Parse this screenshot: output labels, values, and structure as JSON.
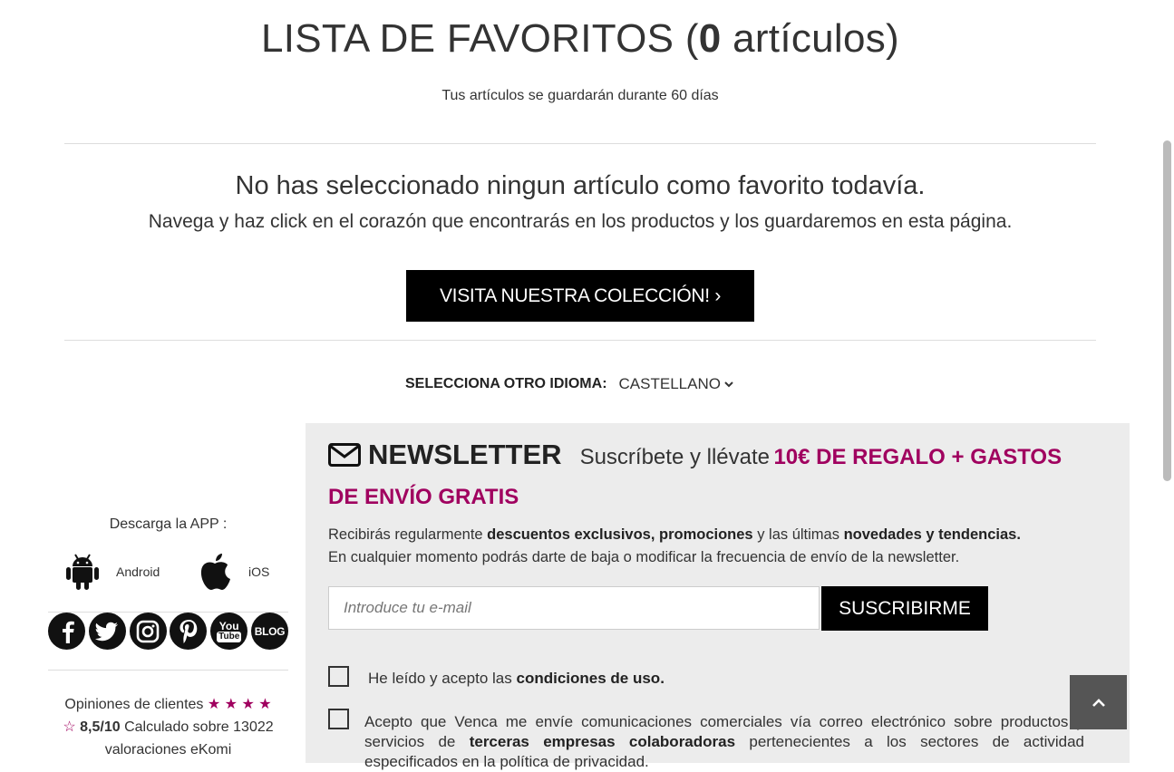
{
  "page": {
    "title_prefix": "LISTA DE FAVORITOS (",
    "title_count": "0",
    "title_suffix": " artículos)",
    "subtitle": "Tus artículos se guardarán durante 60 días"
  },
  "empty_state": {
    "heading": "No has seleccionado ningun artículo como favorito todavía.",
    "text": "Navega y haz click en el corazón que encontrarás en los productos y los guardaremos en esta página.",
    "cta_label": "VISITA NUESTRA COLECCIÓN! ›"
  },
  "language": {
    "label": "SELECCIONA OTRO IDIOMA:",
    "selected": "CASTELLANO"
  },
  "app": {
    "title": "Descarga la APP :",
    "android_label": "Android",
    "ios_label": "iOS"
  },
  "social": {
    "icons": [
      "facebook-icon",
      "twitter-icon",
      "instagram-icon",
      "pinterest-icon",
      "youtube-icon",
      "blog-icon"
    ],
    "youtube_text_1": "You",
    "youtube_text_2": "Tube",
    "blog_text": "BLOG"
  },
  "opinions": {
    "prefix": "Opiniones de clientes",
    "score": "8,5/10",
    "calc": "Calculado sobre 13022",
    "source": "valoraciones eKomi",
    "stars_full": "★ ★ ★ ★",
    "star_empty": "☆"
  },
  "newsletter": {
    "title": "NEWSLETTER",
    "promo_prefix": "Suscríbete y llévate",
    "promo_highlight_1": "10€ DE REGALO + GASTOS",
    "promo_highlight_2": "DE ENVÍO GRATIS",
    "desc_1": "Recibirás regularmente",
    "desc_b1": "descuentos exclusivos, promociones",
    "desc_2": "y las últimas",
    "desc_b2": "novedades y tendencias.",
    "desc_line2": "En cualquier momento podrás darte de baja o modificar la frecuencia de envío de la newsletter.",
    "email_placeholder": "Introduce tu e-mail",
    "subscribe_label": "SUSCRIBIRME",
    "terms_prefix": "He leído y acepto las",
    "terms_bold": "condiciones de uso.",
    "consent_1": "Acepto que Venca me envíe comunicaciones comerciales vía correo electrónico sobre productos y servicios de",
    "consent_bold": "terceras empresas colaboradoras",
    "consent_2": "pertenecientes a los sectores de actividad especificados en la política de privacidad."
  },
  "colors": {
    "accent": "#a0005f",
    "button": "#000000",
    "newsletter_bg": "#ececec"
  }
}
